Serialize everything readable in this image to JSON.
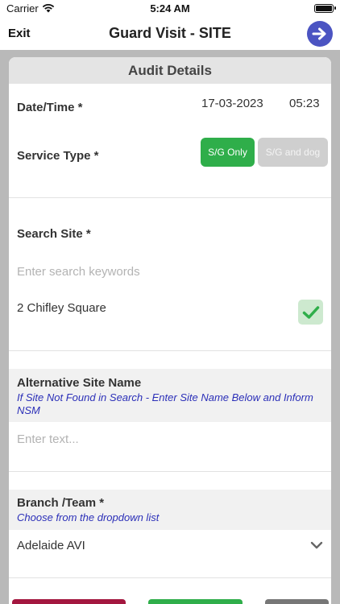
{
  "status": {
    "carrier": "Carrier",
    "time": "5:24 AM"
  },
  "nav": {
    "exit_label": "Exit",
    "title": "Guard Visit - SITE"
  },
  "card": {
    "header": "Audit Details"
  },
  "audit": {
    "date_label": "Date/Time *",
    "date_value": "17-03-2023",
    "time_value": "05:23",
    "service_label": "Service Type *",
    "service_options": [
      "S/G Only",
      "S/G and dog"
    ],
    "service_selected": "S/G Only"
  },
  "site": {
    "search_label": "Search Site *",
    "search_placeholder": "Enter search keywords",
    "result": "2 Chifley Square",
    "result_selected": true
  },
  "alt_site": {
    "label": "Alternative Site Name",
    "hint": "If Site Not Found in Search  - Enter Site Name Below and Inform NSM",
    "placeholder": "Enter text..."
  },
  "branch": {
    "label": "Branch /Team *",
    "hint": "Choose from the dropdown list",
    "value": "Adelaide AVI"
  },
  "colors": {
    "accent_blue": "#4b54c2",
    "selected_green": "#2fae4a",
    "hint_blue": "#2b2fb8",
    "bottom_red": "#a3173f",
    "bottom_green": "#2fae4a",
    "bottom_gray": "#777777"
  }
}
